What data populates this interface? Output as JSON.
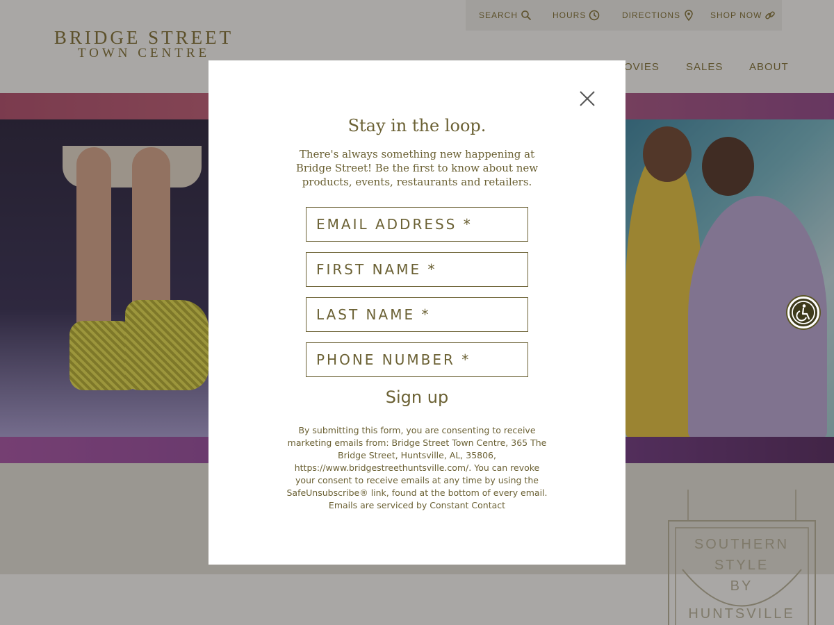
{
  "site": {
    "logo_line1": "BRIDGE STREET",
    "logo_line2": "TOWN CENTRE"
  },
  "utility_nav": [
    {
      "label": "SEARCH",
      "icon": "search-icon"
    },
    {
      "label": "HOURS",
      "icon": "clock-icon"
    },
    {
      "label": "DIRECTIONS",
      "icon": "map-pin-icon"
    },
    {
      "label": "SHOP NOW",
      "icon": "link-icon"
    }
  ],
  "main_nav": {
    "movies_partial": "OVIES",
    "sales": "SALES",
    "about": "ABOUT"
  },
  "badge": {
    "line1": "SOUTHERN",
    "line2": "STYLE",
    "line3": "BY",
    "line4": "HUNTSVILLE"
  },
  "modal": {
    "title": "Stay in the loop.",
    "description": "There's always something new happening at Bridge Street! Be the first to know about new products, events, restaurants and retailers.",
    "fields": {
      "email_placeholder": "EMAIL ADDRESS *",
      "first_name_placeholder": "FIRST NAME *",
      "last_name_placeholder": "LAST NAME *",
      "phone_placeholder": "PHONE NUMBER *"
    },
    "signup_label": "Sign up",
    "legal_text": "By submitting this form, you are consenting to receive marketing emails from: Bridge Street Town Centre, 365 The Bridge Street, Huntsville, AL, 35806, https://www.bridgestreethuntsville.com/. You can revoke your consent to receive emails at any time by using the SafeUnsubscribe® link, found at the bottom of every email. Emails are serviced by Constant Contact"
  },
  "colors": {
    "brand_olive": "#6b6134",
    "overlay": "rgba(50,45,40,0.42)"
  }
}
